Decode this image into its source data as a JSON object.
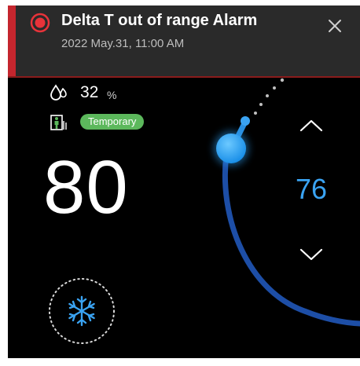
{
  "alarm": {
    "title": "Delta T out of range Alarm",
    "timestamp": "2022 May.31, 11:00 AM",
    "icon": "alarm-icon",
    "close_icon": "close-icon",
    "accent_color": "#c4262e"
  },
  "status": {
    "humidity_value": "32",
    "humidity_unit": "%",
    "humidity_icon": "humidity-icon",
    "occupancy_icon": "occupancy-icon",
    "mode_badge": "Temporary",
    "badge_color": "#5cb85c"
  },
  "temperature": {
    "current": "80",
    "setpoint": "76",
    "setpoint_color": "#3aa3f2"
  },
  "controls": {
    "up_icon": "chevron-up-icon",
    "down_icon": "chevron-down-icon",
    "mode_icon": "snowflake-icon"
  },
  "pager": {
    "pages": 3,
    "active_index": 1
  }
}
